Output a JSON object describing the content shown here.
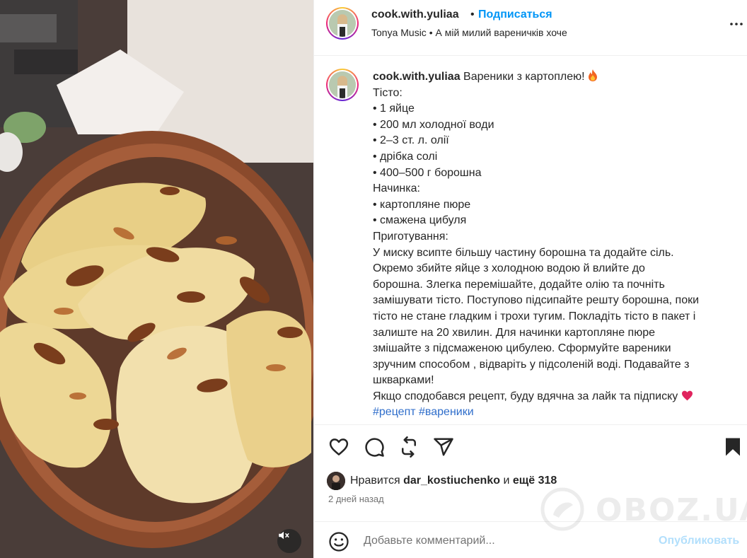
{
  "header": {
    "username": "cook.with.yuliaa",
    "separator": "•",
    "follow_label": "Подписаться",
    "music": "Tonya Music • А мій милий вареничків хоче"
  },
  "caption": {
    "username": "cook.with.yuliaa",
    "title": "Вареники з картоплею!",
    "title_emoji": "fire",
    "lines": [
      "Тісто:",
      "• 1 яйце",
      "• 200 мл холодної води",
      "• 2–3 ст. л. олії",
      "• дрібка солі",
      "• 400–500 г борошна",
      "Начинка:",
      "• картопляне пюре",
      "• смажена цибуля",
      "Приготування:",
      "У миску всипте більшу частину борошна та додайте сіль.",
      "Окремо збийте яйце з холодною водою й влийте до",
      "борошна. Злегка перемішайте, додайте олію та почніть",
      "замішувати тісто. Поступово підсипайте решту борошна, поки",
      "тісто не стане гладким і трохи тугим. Покладіть тісто в пакет і",
      "залиште на 20 хвилин. Для начинки картопляне пюре",
      "змішайте з підсмаженою цибулею. Сформуйте вареники",
      "зручним способом , відваріть у підсоленій воді. Подавайте з",
      "шкварками!"
    ],
    "closing": "Якщо сподобався рецепт, буду вдячна за лайк та підписку",
    "closing_emoji": "heart",
    "hashtags": [
      "#рецепт",
      "#вареники"
    ]
  },
  "likes": {
    "prefix": "Нравится",
    "user": "dar_kostiuchenko",
    "joiner": "и",
    "rest": "ещё 318"
  },
  "date": "2 дней назад",
  "comment": {
    "placeholder": "Добавьте комментарий...",
    "publish_label": "Опубликовать"
  },
  "watermark": "OBOZ.UA",
  "icons": {
    "like": "heart-icon",
    "comment": "comment-icon",
    "repost": "repost-icon",
    "share": "share-icon",
    "save": "bookmark-icon",
    "more": "more-icon",
    "mute": "muted-speaker-icon",
    "emoji": "emoji-icon"
  },
  "colors": {
    "link_blue": "#0095f6",
    "publish_disabled": "#b2dffc",
    "hashtag": "#2f6ecb",
    "text": "#262626",
    "muted": "#737373"
  }
}
